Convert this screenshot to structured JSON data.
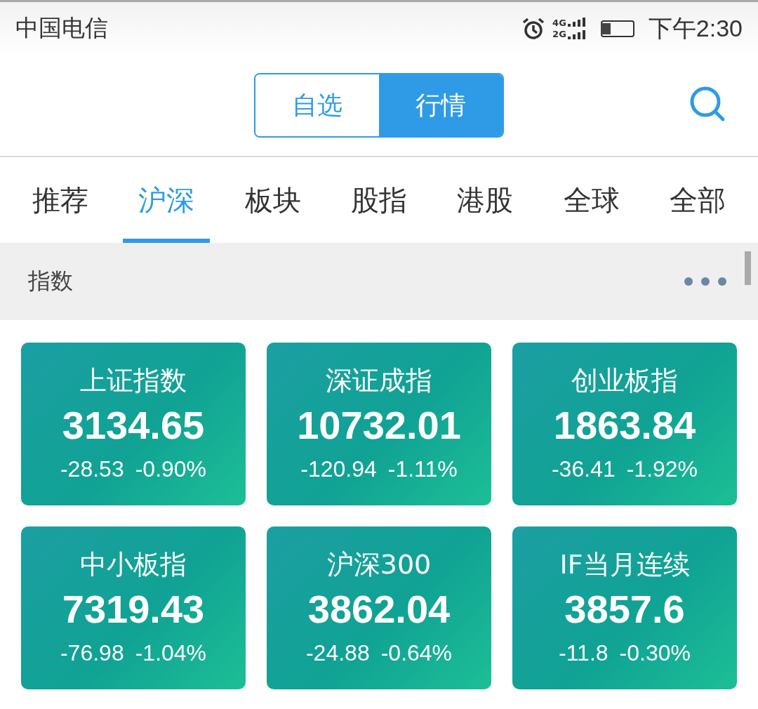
{
  "status_bar": {
    "carrier": "中国电信",
    "network_labels": [
      "4G",
      "2G"
    ],
    "battery": {
      "level": 0.3
    },
    "time": "下午2:30"
  },
  "header": {
    "segments": [
      {
        "label": "自选",
        "selected": false
      },
      {
        "label": "行情",
        "selected": true
      }
    ]
  },
  "tabs": [
    {
      "label": "推荐",
      "selected": false
    },
    {
      "label": "沪深",
      "selected": true
    },
    {
      "label": "板块",
      "selected": false
    },
    {
      "label": "股指",
      "selected": false
    },
    {
      "label": "港股",
      "selected": false
    },
    {
      "label": "全球",
      "selected": false
    },
    {
      "label": "全部",
      "selected": false
    }
  ],
  "section": {
    "title": "指数"
  },
  "cards": [
    {
      "name": "上证指数",
      "value": "3134.65",
      "change": "-28.53",
      "percent": "-0.90%"
    },
    {
      "name": "深证成指",
      "value": "10732.01",
      "change": "-120.94",
      "percent": "-1.11%"
    },
    {
      "name": "创业板指",
      "value": "1863.84",
      "change": "-36.41",
      "percent": "-1.92%"
    },
    {
      "name": "中小板指",
      "value": "7319.43",
      "change": "-76.98",
      "percent": "-1.04%"
    },
    {
      "name": "沪深300",
      "value": "3862.04",
      "change": "-24.88",
      "percent": "-0.64%"
    },
    {
      "name": "IF当月连续",
      "value": "3857.6",
      "change": "-11.8",
      "percent": "-0.30%"
    }
  ]
}
